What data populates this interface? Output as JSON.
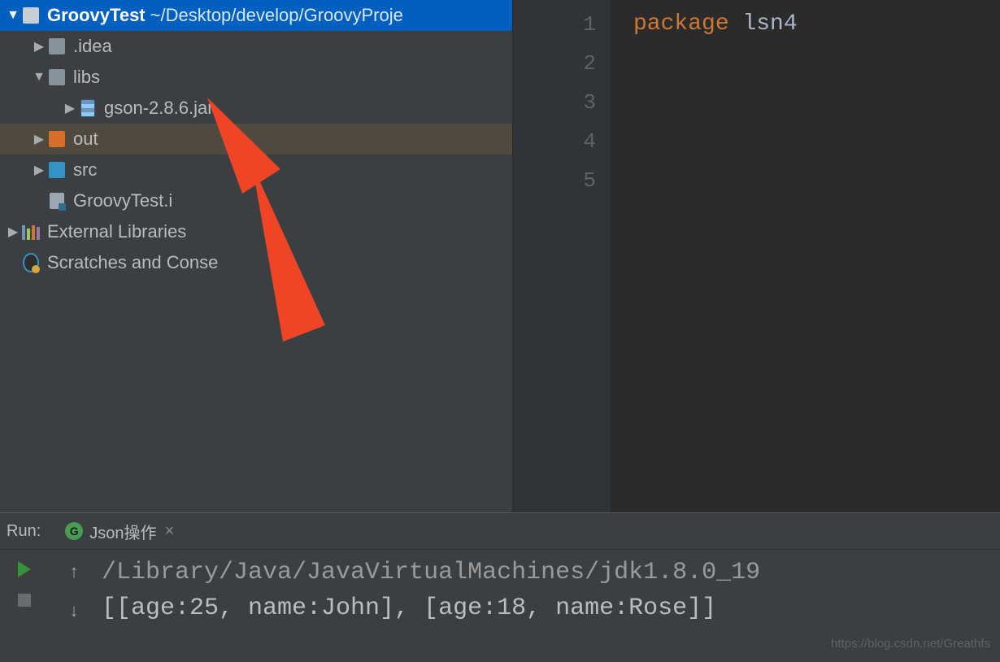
{
  "project": {
    "root_name": "GroovyTest",
    "root_path": "~/Desktop/develop/GroovyProje",
    "nodes": {
      "idea": ".idea",
      "libs": "libs",
      "gson_jar": "gson-2.8.6.jar",
      "out": "out",
      "src": "src",
      "iml": "GroovyTest.i",
      "ext_libs": "External Libraries",
      "scratches": "Scratches and Conse"
    }
  },
  "editor": {
    "line_numbers": [
      "1",
      "2",
      "3",
      "4",
      "5"
    ],
    "keyword": "package",
    "pkg_name": "lsn4"
  },
  "run": {
    "label": "Run:",
    "badge": "G",
    "tab": "Json操作",
    "close": "×",
    "line1": "/Library/Java/JavaVirtualMachines/jdk1.8.0_19",
    "line2": "[[age:25, name:John], [age:18, name:Rose]]"
  },
  "watermark": "https://blog.csdn.net/Greathfs"
}
